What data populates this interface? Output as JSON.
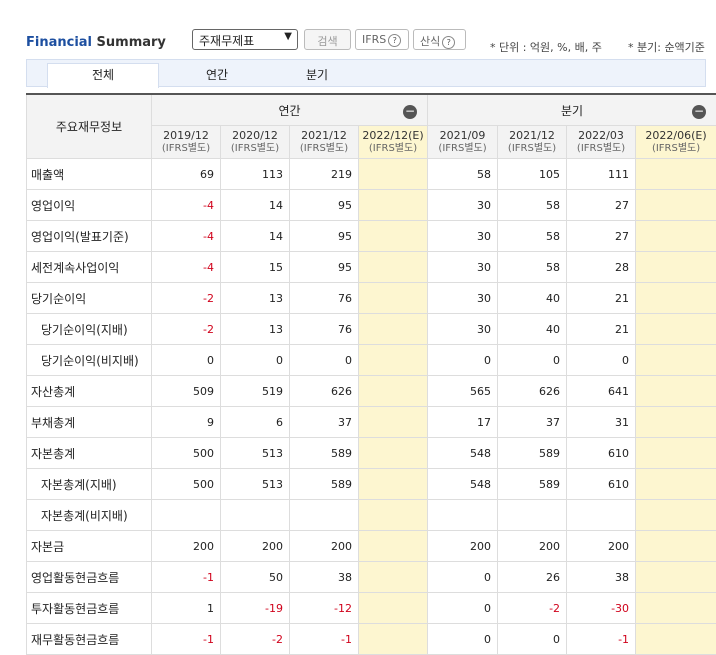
{
  "header": {
    "title_part1": "Financial",
    "title_part2": " Summary",
    "select_value": "주재무제표",
    "search_label": "검색",
    "ifrs_label": "IFRS",
    "formula_label": "산식",
    "help_icon": "?",
    "unit_text": "* 단위 : 억원, %, 배, 주",
    "quarter_text": "* 분기: 순액기준"
  },
  "tabs": [
    "전체",
    "연간",
    "분기"
  ],
  "table": {
    "row_header": "주요재무정보",
    "group_annual": "연간",
    "group_quarter": "분기",
    "collapse_icon": "−",
    "columns": [
      {
        "period": "2019/12",
        "basis": "(IFRS별도)",
        "estimate": false
      },
      {
        "period": "2020/12",
        "basis": "(IFRS별도)",
        "estimate": false
      },
      {
        "period": "2021/12",
        "basis": "(IFRS별도)",
        "estimate": false
      },
      {
        "period": "2022/12(E)",
        "basis": "(IFRS별도)",
        "estimate": true
      },
      {
        "period": "2021/09",
        "basis": "(IFRS별도)",
        "estimate": false
      },
      {
        "period": "2021/12",
        "basis": "(IFRS별도)",
        "estimate": false
      },
      {
        "period": "2022/03",
        "basis": "(IFRS별도)",
        "estimate": false
      },
      {
        "period": "2022/06(E)",
        "basis": "(IFRS별도)",
        "estimate": true
      }
    ],
    "rows": [
      {
        "label": "매출액",
        "indent": false,
        "values": [
          "69",
          "113",
          "219",
          "",
          "58",
          "105",
          "111",
          ""
        ]
      },
      {
        "label": "영업이익",
        "indent": false,
        "values": [
          "-4",
          "14",
          "95",
          "",
          "30",
          "58",
          "27",
          ""
        ]
      },
      {
        "label": "영업이익(발표기준)",
        "indent": false,
        "values": [
          "-4",
          "14",
          "95",
          "",
          "30",
          "58",
          "27",
          ""
        ]
      },
      {
        "label": "세전계속사업이익",
        "indent": false,
        "values": [
          "-4",
          "15",
          "95",
          "",
          "30",
          "58",
          "28",
          ""
        ]
      },
      {
        "label": "당기순이익",
        "indent": false,
        "values": [
          "-2",
          "13",
          "76",
          "",
          "30",
          "40",
          "21",
          ""
        ]
      },
      {
        "label": "당기순이익(지배)",
        "indent": true,
        "values": [
          "-2",
          "13",
          "76",
          "",
          "30",
          "40",
          "21",
          ""
        ]
      },
      {
        "label": "당기순이익(비지배)",
        "indent": true,
        "values": [
          "0",
          "0",
          "0",
          "",
          "0",
          "0",
          "0",
          ""
        ]
      },
      {
        "label": "자산총계",
        "indent": false,
        "values": [
          "509",
          "519",
          "626",
          "",
          "565",
          "626",
          "641",
          ""
        ]
      },
      {
        "label": "부채총계",
        "indent": false,
        "values": [
          "9",
          "6",
          "37",
          "",
          "17",
          "37",
          "31",
          ""
        ]
      },
      {
        "label": "자본총계",
        "indent": false,
        "values": [
          "500",
          "513",
          "589",
          "",
          "548",
          "589",
          "610",
          ""
        ]
      },
      {
        "label": "자본총계(지배)",
        "indent": true,
        "values": [
          "500",
          "513",
          "589",
          "",
          "548",
          "589",
          "610",
          ""
        ]
      },
      {
        "label": "자본총계(비지배)",
        "indent": true,
        "values": [
          "",
          "",
          "",
          "",
          "",
          "",
          "",
          ""
        ]
      },
      {
        "label": "자본금",
        "indent": false,
        "values": [
          "200",
          "200",
          "200",
          "",
          "200",
          "200",
          "200",
          ""
        ]
      },
      {
        "label": "영업활동현금흐름",
        "indent": false,
        "values": [
          "-1",
          "50",
          "38",
          "",
          "0",
          "26",
          "38",
          ""
        ]
      },
      {
        "label": "투자활동현금흐름",
        "indent": false,
        "values": [
          "1",
          "-19",
          "-12",
          "",
          "0",
          "-2",
          "-30",
          ""
        ]
      },
      {
        "label": "재무활동현금흐름",
        "indent": false,
        "values": [
          "-1",
          "-2",
          "-1",
          "",
          "0",
          "0",
          "-1",
          ""
        ]
      }
    ]
  },
  "colors": {
    "negative": "#d0021b",
    "estimate_bg": "#fdf6d0",
    "title_blue": "#1d4fa0"
  }
}
